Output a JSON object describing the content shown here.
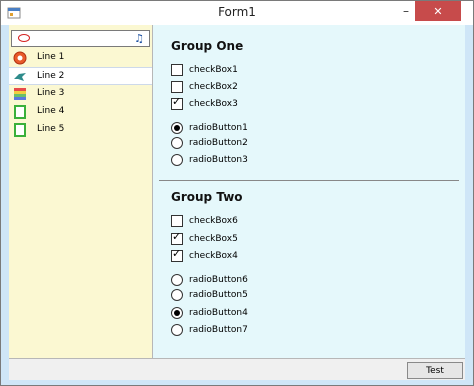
{
  "window": {
    "title": "Form1"
  },
  "sidebar": {
    "items": [
      {
        "label": "Line 1",
        "icon": "red-circle-icon",
        "selected": false
      },
      {
        "label": "Line 2",
        "icon": "teal-bird-icon",
        "selected": true
      },
      {
        "label": "Line 3",
        "icon": "color-gradient-icon",
        "selected": false
      },
      {
        "label": "Line 4",
        "icon": "green-frame-icon",
        "selected": false
      },
      {
        "label": "Line 5",
        "icon": "green-frame-icon",
        "selected": false
      }
    ]
  },
  "group_one": {
    "title": "Group One",
    "checkboxes": [
      {
        "label": "checkBox1",
        "checked": false
      },
      {
        "label": "checkBox2",
        "checked": false
      },
      {
        "label": "checkBox3",
        "checked": true
      }
    ],
    "radios": [
      {
        "label": "radioButton1",
        "checked": true
      },
      {
        "label": "radioButton2",
        "checked": false
      },
      {
        "label": "radioButton3",
        "checked": false
      }
    ]
  },
  "group_two": {
    "title": "Group Two",
    "checkboxes": [
      {
        "label": "checkBox6",
        "checked": false
      },
      {
        "label": "checkBox5",
        "checked": true
      },
      {
        "label": "checkBox4",
        "checked": true
      }
    ],
    "radios": [
      {
        "label": "radioButton6",
        "checked": false
      },
      {
        "label": "radioButton5",
        "checked": false
      },
      {
        "label": "radioButton4",
        "checked": true
      },
      {
        "label": "radioButton7",
        "checked": false
      }
    ]
  },
  "footer": {
    "test_label": "Test"
  }
}
